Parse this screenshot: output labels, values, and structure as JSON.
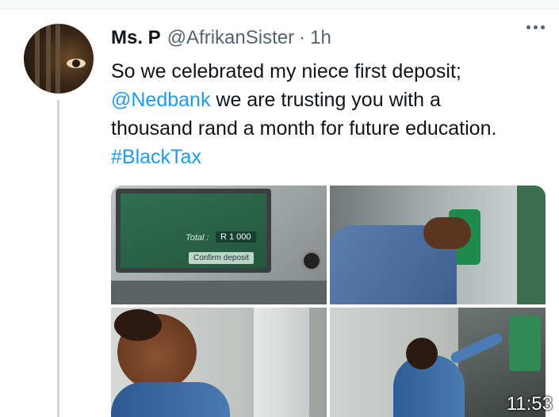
{
  "tweet": {
    "author_name": "Ms. P",
    "handle": "@AfrikanSister",
    "separator": "·",
    "time": "1h",
    "text_line1": "So we celebrated my niece first deposit;",
    "mention": "@Nedbank",
    "text_line2_rest": " we are trusting you with a",
    "text_line3": "thousand rand a month for future education.",
    "hashtag": "#BlackTax"
  },
  "media": {
    "photos": [
      {
        "name": "atm-screen-photo",
        "screen_total_label": "Total :",
        "screen_amount": "R 1 000",
        "screen_button": "Confirm deposit"
      },
      {
        "name": "atm-slot-photo"
      },
      {
        "name": "smiling-girl-photo"
      },
      {
        "name": "girl-at-atm-photo"
      }
    ]
  },
  "status_bar": {
    "clock": "11:53"
  },
  "colors": {
    "link": "#1d9bf0",
    "secondary_text": "#536471",
    "thread_line": "#cfd9de"
  },
  "icons": {
    "more": "more-horizontal-icon"
  }
}
